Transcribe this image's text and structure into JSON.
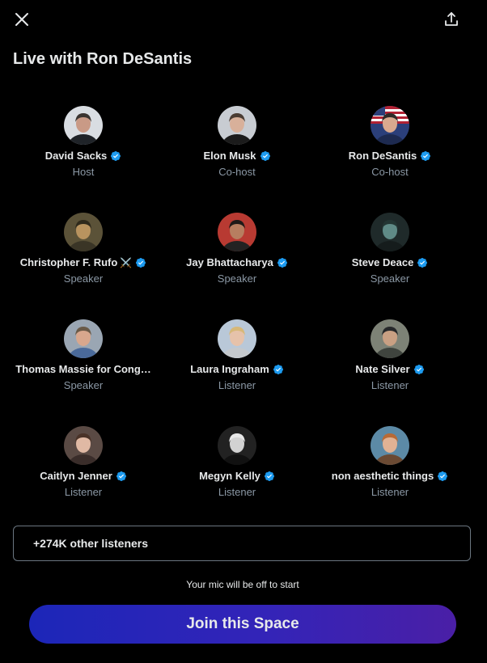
{
  "header": {
    "title": "Live with Ron DeSantis",
    "close_icon": "close-icon",
    "share_icon": "share-icon"
  },
  "participants": [
    {
      "name": "David Sacks",
      "role": "Host",
      "verified": true
    },
    {
      "name": "Elon Musk",
      "role": "Co-host",
      "verified": true
    },
    {
      "name": "Ron DeSantis",
      "role": "Co-host",
      "verified": true
    },
    {
      "name": "Christopher F. Rufo",
      "emoji": "⚔️",
      "role": "Speaker",
      "verified": true
    },
    {
      "name": "Jay Bhattacharya",
      "role": "Speaker",
      "verified": true
    },
    {
      "name": "Steve Deace",
      "role": "Speaker",
      "verified": true
    },
    {
      "name": "Thomas Massie for Cong…",
      "role": "Speaker",
      "verified": false
    },
    {
      "name": "Laura Ingraham",
      "role": "Listener",
      "verified": true
    },
    {
      "name": "Nate Silver",
      "role": "Listener",
      "verified": true
    },
    {
      "name": "Caitlyn Jenner",
      "role": "Listener",
      "verified": true
    },
    {
      "name": "Megyn Kelly",
      "role": "Listener",
      "verified": true
    },
    {
      "name": "non aesthetic things",
      "role": "Listener",
      "verified": true
    }
  ],
  "listeners": {
    "label": "+274K other listeners"
  },
  "mic_note": "Your mic will be off to start",
  "join_button": "Join this Space",
  "colors": {
    "background": "#000000",
    "verified_badge": "#1d9bf0",
    "role_text": "#8b98a5",
    "join_gradient_start": "#1c26b8",
    "join_gradient_end": "#4a1fa6"
  }
}
